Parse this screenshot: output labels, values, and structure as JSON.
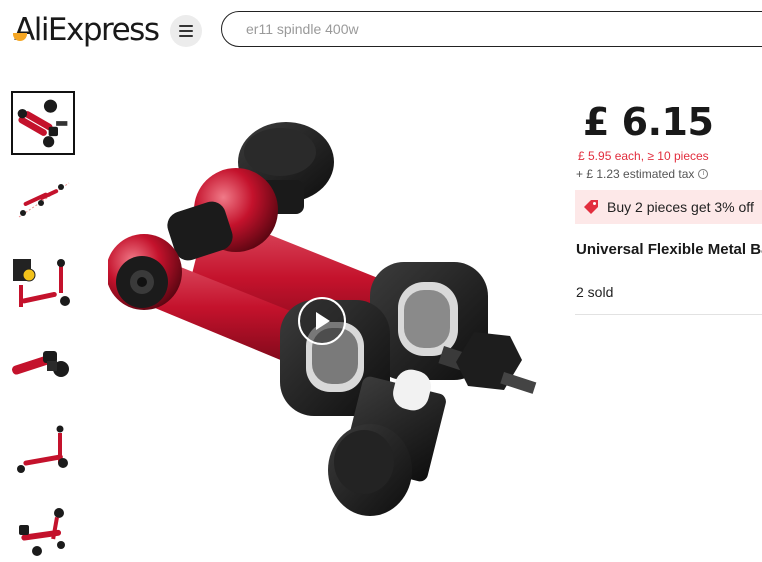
{
  "header": {
    "logo_text": "AliExpress",
    "search_placeholder": "er11 spindle 400w"
  },
  "gallery": {
    "thumbnail_count": 6,
    "selected_index": 0,
    "has_video": true
  },
  "product": {
    "price": "£ 6.15",
    "bulk_price": "£ 5.95 each, ≥ 10 pieces",
    "estimated_tax": "+ £ 1.23 estimated tax",
    "promo_text": "Buy 2 pieces get 3% off",
    "title": "Universal Flexible Metal Base Holder",
    "sold": "2 sold"
  },
  "colors": {
    "accent_red": "#e22e3e",
    "promo_bg": "#fde8e8",
    "product_red": "#c4122c"
  },
  "icons": {
    "menu": "hamburger-icon",
    "play": "play-icon",
    "promo": "tag-icon",
    "info": "info-icon"
  }
}
